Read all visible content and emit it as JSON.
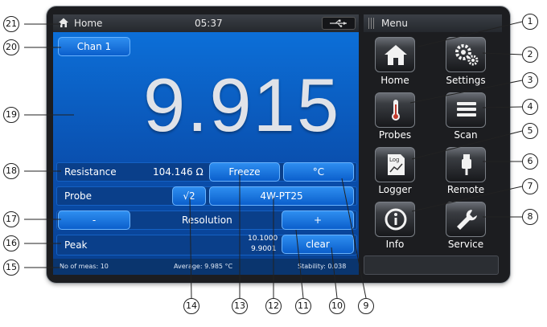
{
  "status": {
    "title": "Home",
    "time": "05:37"
  },
  "main": {
    "channel_button": "Chan 1",
    "reading": "9.915",
    "resistance_label": "Resistance",
    "resistance_value": "104.146 Ω",
    "freeze_button": "Freeze",
    "unit_button": "°C",
    "probe_label": "Probe",
    "sqrt_button": "√2",
    "probe_type": "4W-PT25",
    "resolution_minus": "-",
    "resolution_label": "Resolution",
    "resolution_plus": "+",
    "peak_label": "Peak",
    "peak_max": "10.1000",
    "peak_min": "9.9001",
    "clear_button": "clear",
    "meas_count": "No of meas: 10",
    "average": "Average: 9.985 °C",
    "stability": "Stability: 0.038"
  },
  "menu": {
    "title": "Menu",
    "tiles": [
      {
        "label": "Home",
        "icon": "home-icon"
      },
      {
        "label": "Settings",
        "icon": "gears-icon"
      },
      {
        "label": "Probes",
        "icon": "thermometer-icon"
      },
      {
        "label": "Scan",
        "icon": "list-icon"
      },
      {
        "label": "Logger",
        "icon": "log-chart-icon"
      },
      {
        "label": "Remote",
        "icon": "usb-plug-icon"
      },
      {
        "label": "Info",
        "icon": "info-icon"
      },
      {
        "label": "Service",
        "icon": "wrench-icon"
      }
    ]
  },
  "callouts": {
    "n1": "1",
    "n2": "2",
    "n3": "3",
    "n4": "4",
    "n5": "5",
    "n6": "6",
    "n7": "7",
    "n8": "8",
    "n9": "9",
    "n10": "10",
    "n11": "11",
    "n12": "12",
    "n13": "13",
    "n14": "14",
    "n15": "15",
    "n16": "16",
    "n17": "17",
    "n18": "18",
    "n19": "19",
    "n20": "20",
    "n21": "21"
  },
  "colors": {
    "panel_blue": "#0a4fae",
    "button_blue": "#0b5fcc",
    "tile_dark": "#17181b"
  }
}
